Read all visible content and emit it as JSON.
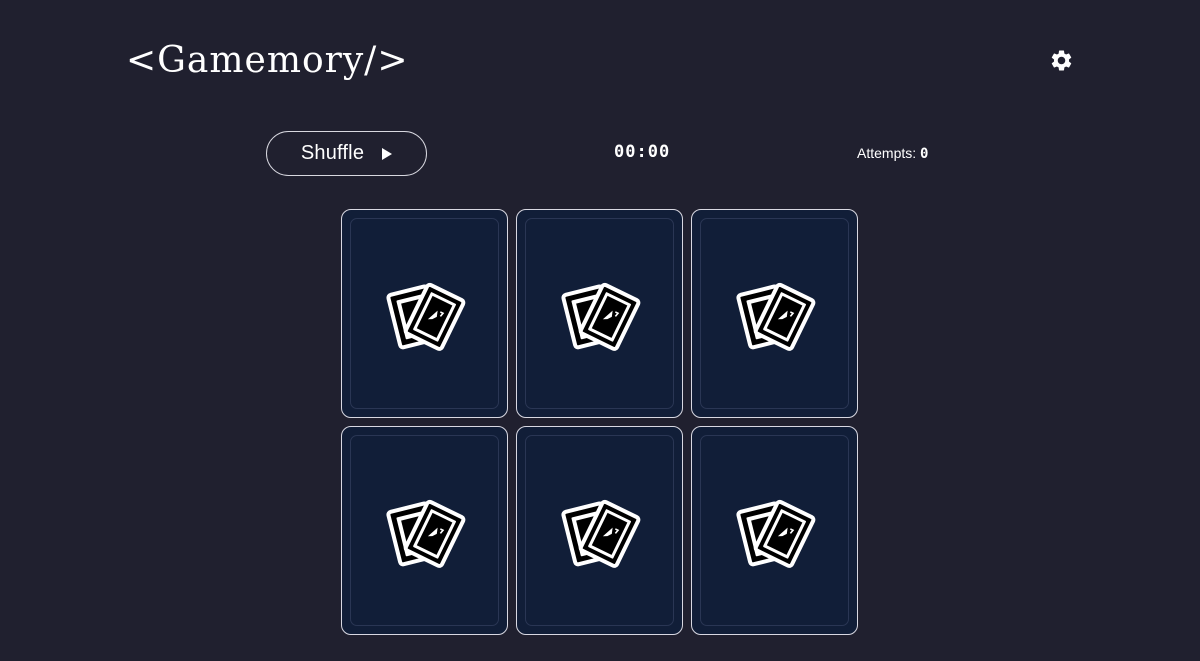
{
  "header": {
    "logo": "<Gamemory/>",
    "settings_icon": "gear-icon"
  },
  "controls": {
    "shuffle_label": "Shuffle",
    "shuffle_icon": "play-icon",
    "timer": "00:00",
    "attempts_label": "Attempts:",
    "attempts_value": "0"
  },
  "board": {
    "cards": [
      {
        "state": "face-down",
        "icon": "cards-icon"
      },
      {
        "state": "face-down",
        "icon": "cards-icon"
      },
      {
        "state": "face-down",
        "icon": "cards-icon"
      },
      {
        "state": "face-down",
        "icon": "cards-icon"
      },
      {
        "state": "face-down",
        "icon": "cards-icon"
      },
      {
        "state": "face-down",
        "icon": "cards-icon"
      }
    ]
  },
  "colors": {
    "background": "#20202f",
    "card_back": "#111e38",
    "foreground": "#ffffff"
  }
}
